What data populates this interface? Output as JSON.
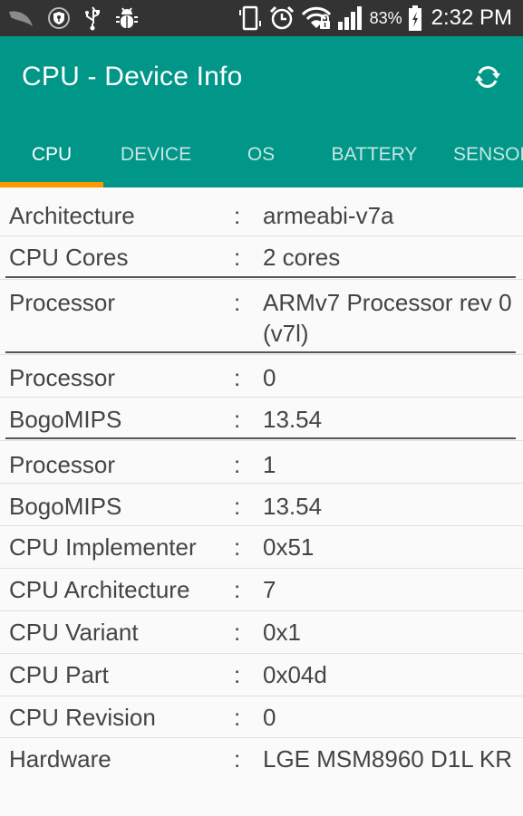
{
  "status_bar": {
    "left_icons": [
      "leaf-icon",
      "shield-key-icon",
      "usb-icon",
      "android-debug-icon"
    ],
    "right_icons": [
      "vibrate-icon",
      "alarm-icon",
      "wifi-locked-icon",
      "signal-icon"
    ],
    "battery_percent": "83%",
    "battery_icon": "battery-charging-icon",
    "time": "2:32 PM"
  },
  "app_bar": {
    "title": "CPU - Device Info",
    "refresh_icon": "refresh-icon"
  },
  "tabs": [
    {
      "label": "CPU",
      "active": true
    },
    {
      "label": "DEVICE",
      "active": false
    },
    {
      "label": "OS",
      "active": false
    },
    {
      "label": "BATTERY",
      "active": false
    },
    {
      "label": "SENSORS",
      "active": false
    }
  ],
  "colors": {
    "primary": "#009688",
    "accent_indicator": "#ff9800",
    "status_bar": "#333333",
    "text": "#444444",
    "background": "#fafafa"
  },
  "separator": ":",
  "rows": [
    {
      "label": "Architecture",
      "value": "armeabi-v7a"
    },
    {
      "label": "CPU Cores",
      "value": "2 cores"
    },
    {
      "label": "Processor",
      "value": "ARMv7 Processor rev 0 (v7l)"
    },
    {
      "label": "Processor",
      "value": "0"
    },
    {
      "label": "BogoMIPS",
      "value": "13.54"
    },
    {
      "label": "Processor",
      "value": "1"
    },
    {
      "label": "BogoMIPS",
      "value": "13.54"
    },
    {
      "label": "CPU Implementer",
      "value": "0x51"
    },
    {
      "label": "CPU Architecture",
      "value": "7"
    },
    {
      "label": "CPU Variant",
      "value": "0x1"
    },
    {
      "label": "CPU Part",
      "value": "0x04d"
    },
    {
      "label": "CPU Revision",
      "value": "0"
    },
    {
      "label": "Hardware",
      "value": "LGE MSM8960 D1L KR"
    }
  ]
}
